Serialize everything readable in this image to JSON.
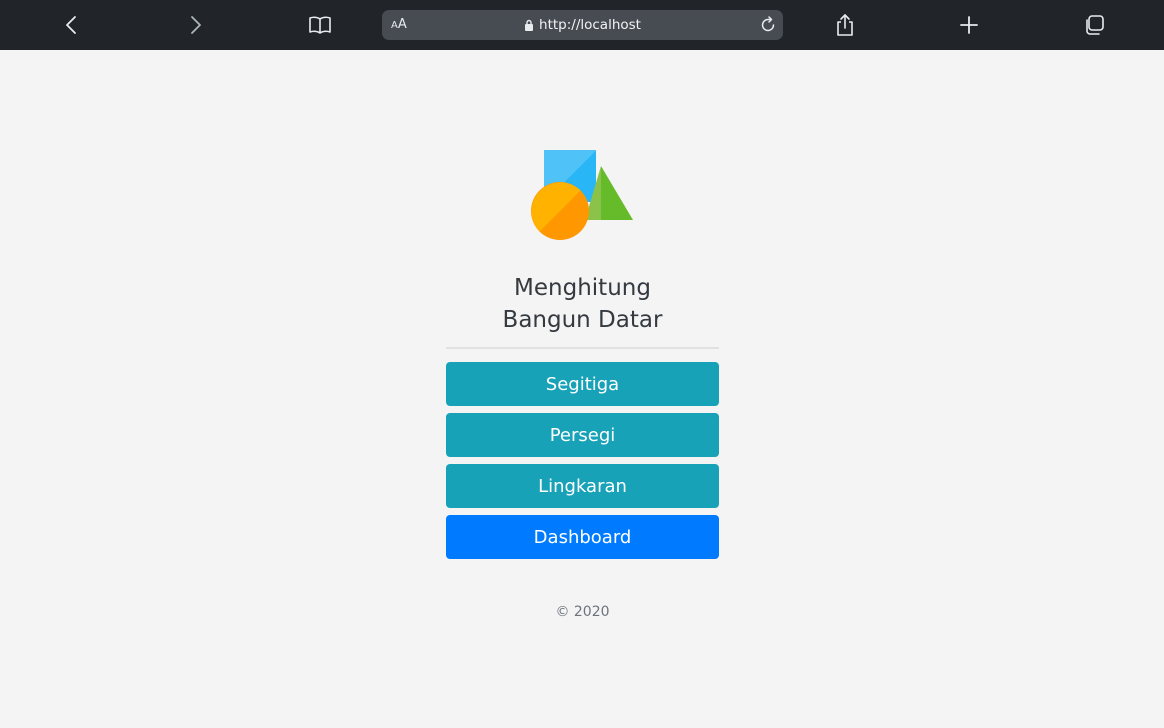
{
  "browser": {
    "text_size_label": "AA",
    "url": "http://localhost"
  },
  "page": {
    "title_line1": "Menghitung",
    "title_line2": "Bangun Datar",
    "menu": [
      {
        "label": "Segitiga"
      },
      {
        "label": "Persegi"
      },
      {
        "label": "Lingkaran"
      },
      {
        "label": "Dashboard"
      }
    ],
    "footer": "© 2020"
  },
  "colors": {
    "toolbar": "#212529",
    "menu_button": "#17a2b8",
    "dashboard_button": "#007bff",
    "background": "#f4f4f4"
  },
  "icons": {
    "back": "chevron-left-icon",
    "forward": "chevron-right-icon",
    "bookmarks": "book-icon",
    "lock": "lock-icon",
    "reload": "reload-icon",
    "share": "share-icon",
    "new_tab": "plus-icon",
    "tabs": "tabs-icon"
  }
}
